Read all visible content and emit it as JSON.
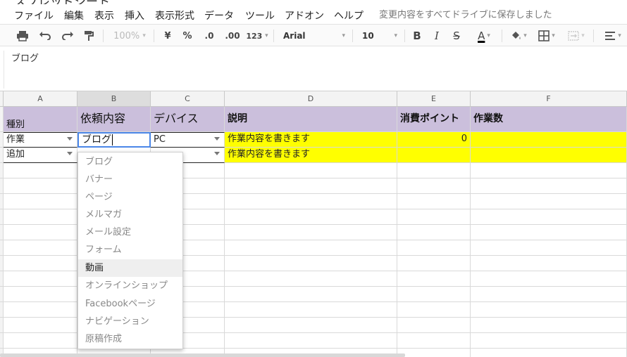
{
  "menubar": {
    "items": [
      "ファイル",
      "編集",
      "表示",
      "挿入",
      "表示形式",
      "データ",
      "ツール",
      "アドオン",
      "ヘルプ"
    ],
    "save_status": "変更内容をすべてドライブに保存しました"
  },
  "toolbar": {
    "zoom": "100%",
    "currency": "¥",
    "percent": "%",
    "decimal_decrease": ".0",
    "decimal_increase": ".00",
    "more_formats": "123",
    "font": "Arial",
    "font_size": "10",
    "bold": "B",
    "italic": "I",
    "strike": "S",
    "text_color": "A",
    "text_color_hex": "#000000"
  },
  "formula_bar": {
    "value": "ブログ"
  },
  "columns": [
    "A",
    "B",
    "C",
    "D",
    "E",
    "F"
  ],
  "header_row": [
    "種別",
    "依頼内容",
    "デバイス",
    "説明",
    "消費ポイント",
    "作業数"
  ],
  "rows": [
    {
      "a": "作業",
      "b": "ブログ",
      "c": "PC",
      "d": "作業内容を書きます",
      "e": "0",
      "f": ""
    },
    {
      "a": "追加",
      "b": "",
      "c": "",
      "d": "作業内容を書きます",
      "e": "",
      "f": ""
    }
  ],
  "dropdown": {
    "options": [
      "ブログ",
      "バナー",
      "ページ",
      "メルマガ",
      "メール設定",
      "フォーム",
      "動画",
      "オンラインショップ",
      "Facebookページ",
      "ナビゲーション",
      "原稿作成"
    ],
    "highlighted": "動画"
  },
  "colors": {
    "header_fill": "#cbbfdc",
    "highlight_fill": "#ffff00",
    "active_border": "#4a86e8"
  }
}
